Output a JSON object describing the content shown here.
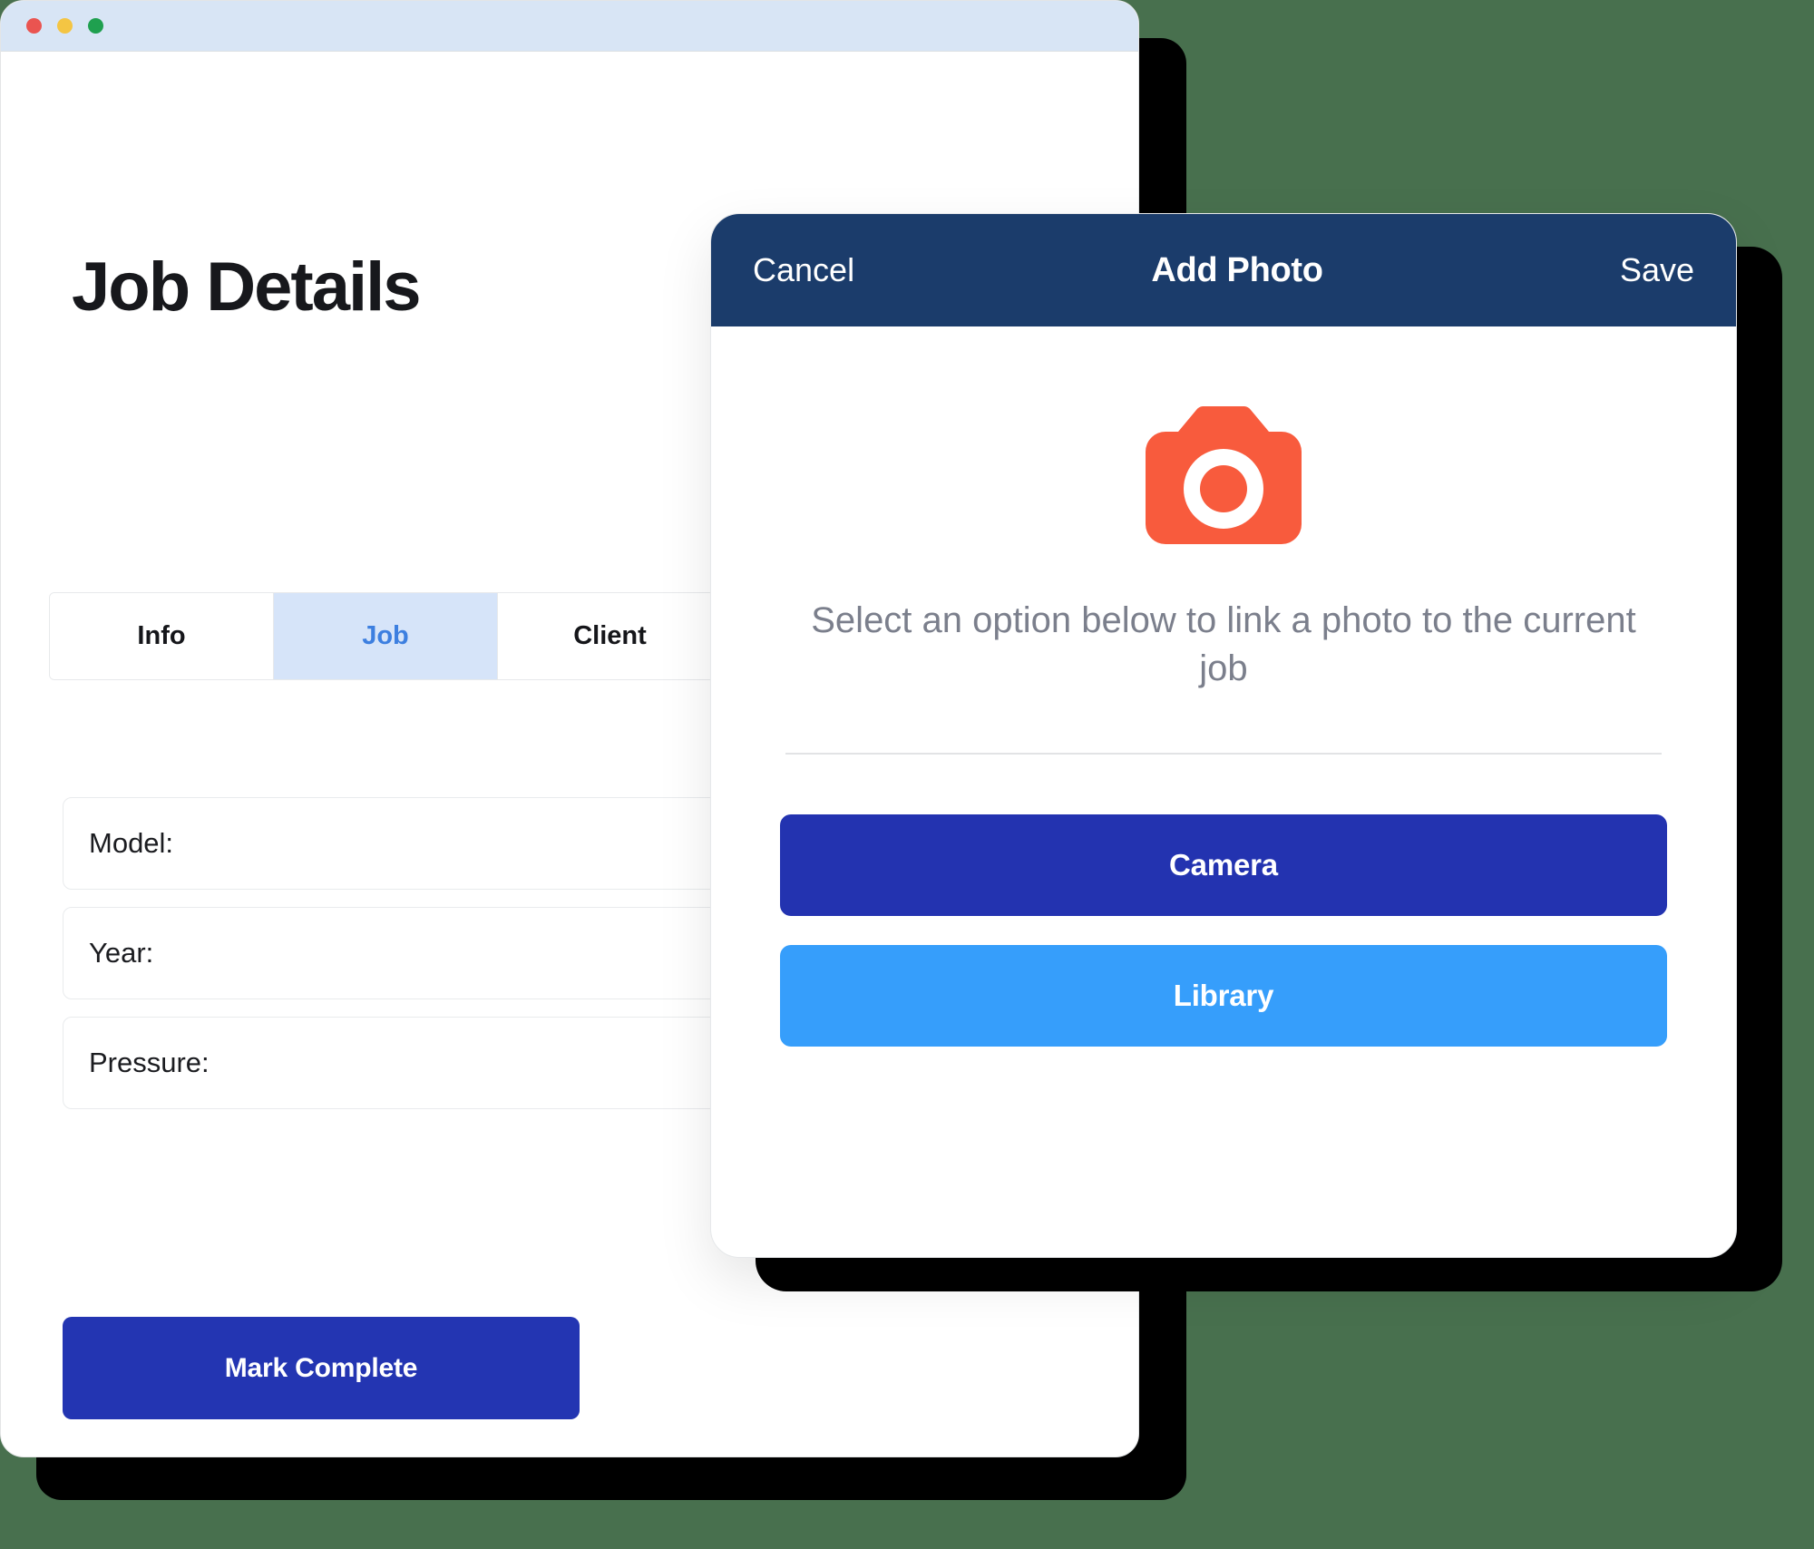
{
  "window": {
    "traffic_lights": [
      {
        "name": "close",
        "color": "#EA5450"
      },
      {
        "name": "minimize",
        "color": "#F4C543"
      },
      {
        "name": "maximize",
        "color": "#1FA04F"
      }
    ]
  },
  "page": {
    "title": "Job Details"
  },
  "tabs": [
    {
      "label": "Info",
      "active": false
    },
    {
      "label": "Job",
      "active": true
    },
    {
      "label": "Client",
      "active": false
    }
  ],
  "form": {
    "fields": [
      {
        "label": "Model:",
        "value": ""
      },
      {
        "label": "Year:",
        "value": ""
      },
      {
        "label": "Pressure:",
        "value": ""
      }
    ],
    "submit_label": "Mark Complete"
  },
  "modal": {
    "cancel_label": "Cancel",
    "title": "Add Photo",
    "save_label": "Save",
    "icon": "camera-icon",
    "description": "Select an option below to link a photo to the current job",
    "actions": [
      {
        "label": "Camera",
        "style": "primary"
      },
      {
        "label": "Library",
        "style": "secondary"
      }
    ]
  },
  "colors": {
    "page_background": "#48704E",
    "titlebar": "#D8E5F5",
    "modal_header": "#1B3C6B",
    "camera_icon": "#F85B3D",
    "primary_button": "#2333B0",
    "secondary_button": "#369EFB",
    "active_tab_bg": "#D6E4F9",
    "active_tab_text": "#3D7FE0",
    "mark_complete": "#2335B2"
  }
}
